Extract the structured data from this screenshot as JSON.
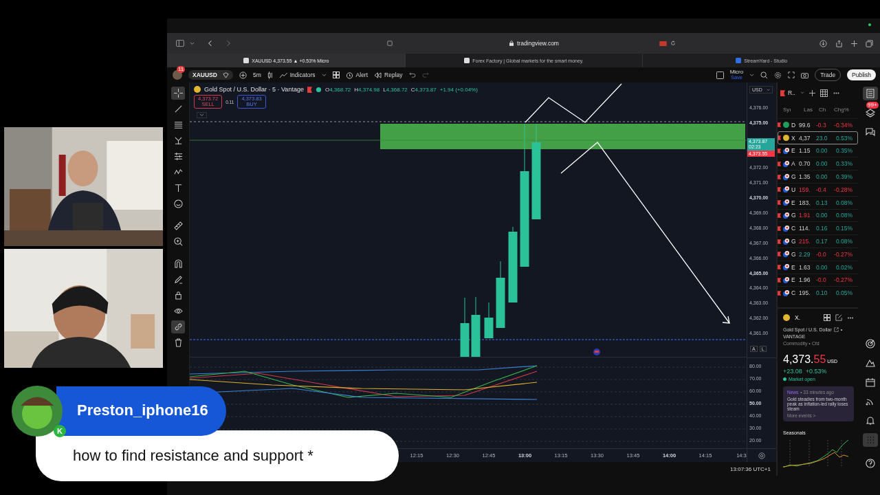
{
  "browser": {
    "url": "tradingview.com",
    "tabs": [
      {
        "label": "XAUUSD 4,373.55 ▲ +0.53% Micro",
        "selected": true
      },
      {
        "label": "Forex Factory | Global markets for the smart money.",
        "selected": false
      },
      {
        "label": "StreamYard - Studio",
        "selected": false
      }
    ]
  },
  "toolbar": {
    "notifications": "11",
    "symbol": "XAUUSD",
    "interval": "5m",
    "indicators": "Indicators",
    "alert": "Alert",
    "replay": "Replay",
    "layout": "Micro",
    "layout_status": "Save",
    "trade": "Trade",
    "publish": "Publish"
  },
  "left_toolbar": [
    {
      "kind": "crosshair",
      "selected": true
    },
    {
      "kind": "line",
      "selected": false
    },
    {
      "kind": "lines",
      "selected": false
    },
    {
      "kind": "nodes",
      "selected": false
    },
    {
      "kind": "sliders",
      "selected": false
    },
    {
      "kind": "wave",
      "selected": false
    },
    {
      "kind": "text",
      "selected": false
    },
    {
      "kind": "smile",
      "selected": false
    },
    {
      "kind": "ruler",
      "selected": false
    },
    {
      "kind": "zoom",
      "selected": false
    },
    {
      "kind": "magnet",
      "selected": false
    },
    {
      "kind": "pencil",
      "selected": false
    },
    {
      "kind": "lock",
      "selected": false
    },
    {
      "kind": "eye",
      "selected": false
    },
    {
      "kind": "link",
      "selected": true
    },
    {
      "kind": "trash",
      "selected": false
    }
  ],
  "legend": {
    "title": "Gold Spot / U.S. Dollar · 5 · Vantage",
    "ohlc": [
      {
        "label": "O",
        "value": "4,368.72"
      },
      {
        "label": "H",
        "value": "4,374.98"
      },
      {
        "label": "L",
        "value": "4,368.72"
      },
      {
        "label": "C",
        "value": "4,373.87"
      }
    ],
    "change": "+1.94 (+0.04%)",
    "sell_price": "4,373.72",
    "sell": "SELL",
    "spread": "0.11",
    "buy_price": "4,373.83",
    "buy": "BUY"
  },
  "price_axis": {
    "currency": "USD",
    "ticks_upper": [
      {
        "label": "4,376.00",
        "major": false
      },
      {
        "label": "4,375.00",
        "major": true
      }
    ],
    "ticks_lower": [
      {
        "label": "4,372.00",
        "major": false
      },
      {
        "label": "4,371.00",
        "major": false
      },
      {
        "label": "4,370.00",
        "major": true
      },
      {
        "label": "4,369.00",
        "major": false
      },
      {
        "label": "4,368.00",
        "major": false
      },
      {
        "label": "4,367.00",
        "major": false
      },
      {
        "label": "4,366.00",
        "major": false
      },
      {
        "label": "4,365.00",
        "major": true
      },
      {
        "label": "4,364.00",
        "major": false
      },
      {
        "label": "4,363.00",
        "major": false
      },
      {
        "label": "4,362.00",
        "major": false
      },
      {
        "label": "4,361.00",
        "major": false
      }
    ],
    "last_price": "4,373.87",
    "countdown": "02:23",
    "bid_price": "4,373.55",
    "buttons": [
      "A",
      "L"
    ]
  },
  "oscillator_axis": [
    {
      "label": "80.00",
      "major": false
    },
    {
      "label": "70.00",
      "major": false
    },
    {
      "label": "60.00",
      "major": false
    },
    {
      "label": "50.00",
      "major": true
    },
    {
      "label": "40.00",
      "major": false
    },
    {
      "label": "30.00",
      "major": false
    },
    {
      "label": "20.00",
      "major": false
    }
  ],
  "time_axis": [
    {
      "label": "12:15",
      "major": false
    },
    {
      "label": "12:30",
      "major": false
    },
    {
      "label": "12:45",
      "major": false
    },
    {
      "label": "13:00",
      "major": true
    },
    {
      "label": "13:15",
      "major": false
    },
    {
      "label": "13:30",
      "major": false
    },
    {
      "label": "13:45",
      "major": false
    },
    {
      "label": "14:00",
      "major": true
    },
    {
      "label": "14:15",
      "major": false
    },
    {
      "label": "14:3",
      "major": false
    }
  ],
  "status_bar": {
    "clock": "13:07:36 UTC+1"
  },
  "watchlist": {
    "name": "R..",
    "columns": [
      "Syı",
      "Las",
      "Ch",
      "Chg%"
    ],
    "rows": [
      {
        "kind": "dollar",
        "symbol": "D",
        "last": "99.6",
        "change": "-0.3",
        "change_pct": "-0.34%",
        "last_up": false,
        "last_down": false,
        "down": true,
        "selected": false
      },
      {
        "kind": "coin",
        "symbol": "X",
        "last": "4,37",
        "change": "23.0",
        "change_pct": "0.53%",
        "last_up": false,
        "last_down": false,
        "down": false,
        "selected": true
      },
      {
        "kind": "pair",
        "symbol": "E",
        "last": "1.15",
        "change": "0.00",
        "change_pct": "0.35%",
        "last_up": false,
        "last_down": false,
        "down": false,
        "selected": false
      },
      {
        "kind": "pair",
        "symbol": "A",
        "last": "0.70",
        "change": "0.00",
        "change_pct": "0.33%",
        "last_up": false,
        "last_down": false,
        "down": false,
        "selected": false
      },
      {
        "kind": "pair",
        "symbol": "G",
        "last": "1.35",
        "change": "0.00",
        "change_pct": "0.39%",
        "last_up": false,
        "last_down": false,
        "down": false,
        "selected": false
      },
      {
        "kind": "pair",
        "symbol": "U",
        "last": "159.",
        "change": "-0.4",
        "change_pct": "-0.28%",
        "last_up": false,
        "last_down": true,
        "down": true,
        "selected": false
      },
      {
        "kind": "pair",
        "symbol": "E",
        "last": "183.",
        "change": "0.13",
        "change_pct": "0.08%",
        "last_up": false,
        "last_down": false,
        "down": false,
        "selected": false
      },
      {
        "kind": "pair",
        "symbol": "G",
        "last": "1.91",
        "change": "0.00",
        "change_pct": "0.08%",
        "last_up": false,
        "last_down": true,
        "down": false,
        "selected": false
      },
      {
        "kind": "pair",
        "symbol": "C",
        "last": "114.",
        "change": "0.16",
        "change_pct": "0.15%",
        "last_up": false,
        "last_down": false,
        "down": false,
        "selected": false
      },
      {
        "kind": "pair",
        "symbol": "G",
        "last": "215.",
        "change": "0.17",
        "change_pct": "0.08%",
        "last_up": false,
        "last_down": true,
        "down": false,
        "selected": false
      },
      {
        "kind": "pair",
        "symbol": "G",
        "last": "2.29",
        "change": "-0.0",
        "change_pct": "-0.27%",
        "last_up": true,
        "last_down": false,
        "down": true,
        "selected": false
      },
      {
        "kind": "pair",
        "symbol": "E",
        "last": "1.63",
        "change": "0.00",
        "change_pct": "0.02%",
        "last_up": false,
        "last_down": false,
        "down": false,
        "selected": false
      },
      {
        "kind": "pair",
        "symbol": "E",
        "last": "1.96",
        "change": "-0.0",
        "change_pct": "-0.27%",
        "last_up": false,
        "last_down": false,
        "down": true,
        "selected": false
      },
      {
        "kind": "pair",
        "symbol": "C",
        "last": "195.",
        "change": "0.10",
        "change_pct": "0.05%",
        "last_up": false,
        "last_down": false,
        "down": false,
        "selected": false
      }
    ]
  },
  "details": {
    "symbol": "X.",
    "name": "Gold Spot / U.S. Dollar",
    "separator": "•",
    "exchange": "VANTAGE",
    "category": "Commodity • Cfd",
    "price": "4,373.",
    "price_decimals": "55",
    "currency": "USD",
    "change": "+23.08",
    "change_pct": "+0.53%",
    "market_status": "Market open",
    "news": {
      "source": "News",
      "time": "• 33 minutes ago",
      "headline": "Gold steadies from two-month peak as inflation-led rally loses steam",
      "more": "More events >"
    },
    "seasonals": "Seasonals"
  },
  "right_rail": {
    "badge": "99+",
    "top": [
      {
        "kind": "watchlist",
        "selected": true
      },
      {
        "kind": "layers",
        "selected": false
      },
      {
        "kind": "chat",
        "selected": false
      }
    ],
    "bottom": [
      {
        "kind": "target",
        "selected": false
      },
      {
        "kind": "mountain",
        "selected": false
      },
      {
        "kind": "calendar",
        "selected": false
      },
      {
        "kind": "signal",
        "selected": false
      },
      {
        "kind": "bell",
        "selected": false
      },
      {
        "kind": "grid",
        "selected": true
      },
      {
        "kind": "help",
        "selected": false
      }
    ]
  },
  "chat_overlay": {
    "user": "Preston_iphone16",
    "badge": "K",
    "message": "how to find resistance and support *"
  }
}
